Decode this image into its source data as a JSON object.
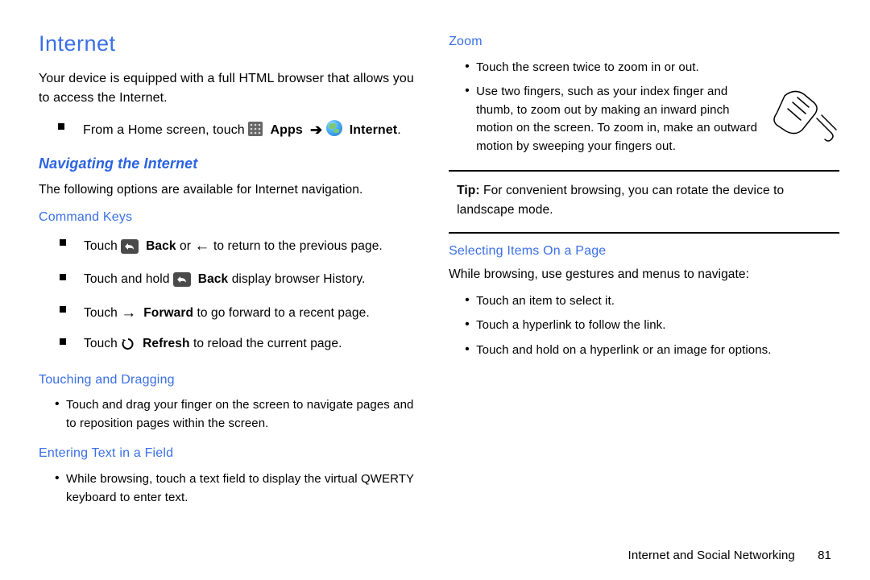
{
  "h1": "Internet",
  "intro": "Your device is equipped with a full HTML browser that allows you to access the Internet.",
  "from_home_prefix": "From a Home screen, touch ",
  "apps_label": "Apps",
  "arrow_label": "➔",
  "internet_label": "Internet",
  "navigating_heading": "Navigating the Internet",
  "navigating_intro": "The following options are available for Internet navigation.",
  "sub_command_keys": "Command Keys",
  "ck": {
    "item1_a": "Touch ",
    "item1_bold": "Back",
    "item1_b": " or ",
    "item1_c": " to return to the previous page.",
    "item2_a": "Touch and hold ",
    "item2_bold": "Back",
    "item2_b": " display browser History.",
    "item3_a": "Touch ",
    "item3_bold": "Forward",
    "item3_b": " to go forward to a recent page.",
    "item4_a": "Touch ",
    "item4_bold": "Refresh",
    "item4_b": " to reload the current page."
  },
  "sub_touch_drag": "Touching and Dragging",
  "touch_drag_item": "Touch and drag your finger on the screen to navigate pages and to reposition pages within the screen.",
  "sub_enter_text": "Entering Text in a Field",
  "enter_text_item": "While browsing, touch a text field to display the virtual QWERTY keyboard to enter text.",
  "sub_zoom": "Zoom",
  "zoom_item1": "Touch the screen twice to zoom in or out.",
  "zoom_item2": "Use two fingers, such as your index finger and thumb, to zoom out by making an inward pinch motion on the screen. To zoom in, make an outward motion by sweeping your fingers out.",
  "tip_bold": "Tip:",
  "tip_text": " For convenient browsing, you can rotate the device to landscape mode.",
  "sub_selecting": "Selecting Items On a Page",
  "selecting_intro": "While browsing, use gestures and menus to navigate:",
  "sel_item1": "Touch an item to select it.",
  "sel_item2": "Touch a hyperlink to follow the link.",
  "sel_item3": "Touch and hold on a hyperlink or an image for options.",
  "footer_label": "Internet and Social Networking",
  "footer_page": "81"
}
